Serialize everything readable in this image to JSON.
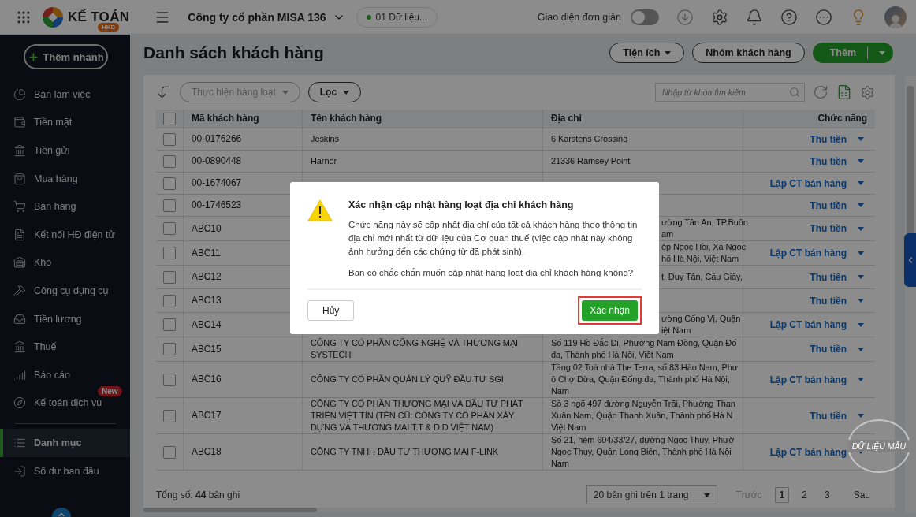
{
  "topbar": {
    "logo_text": "KẾ TOÁN",
    "logo_badge": "HKD",
    "company": "Công ty cổ phần MISA 136",
    "data_pill": "01 Dữ liệu...",
    "simple_ui": {
      "label": "Giao diện đơn giản",
      "on": false
    }
  },
  "sidebar": {
    "quick_add": "Thêm nhanh",
    "items": [
      {
        "label": "Bàn làm việc",
        "selected": false
      },
      {
        "label": "Tiền mặt",
        "selected": false
      },
      {
        "label": "Tiền gửi",
        "selected": false
      },
      {
        "label": "Mua hàng",
        "selected": false
      },
      {
        "label": "Bán hàng",
        "selected": false
      },
      {
        "label": "Kết nối HĐ điện tử",
        "selected": false
      },
      {
        "label": "Kho",
        "selected": false
      },
      {
        "label": "Công cụ dụng cụ",
        "selected": false
      },
      {
        "label": "Tiền lương",
        "selected": false
      },
      {
        "label": "Thuế",
        "selected": false
      },
      {
        "label": "Báo cáo",
        "selected": false
      },
      {
        "label": "Kế toán dịch vụ",
        "selected": false,
        "badge": "New"
      }
    ],
    "bottom_items": [
      {
        "label": "Danh mục",
        "selected": true
      },
      {
        "label": "Số dư ban đầu",
        "selected": false
      }
    ]
  },
  "page": {
    "title": "Danh sách khách hàng",
    "tools_button": "Tiện ích",
    "group_button": "Nhóm khách hàng",
    "add_button": "Thêm"
  },
  "toolbar": {
    "bulk": {
      "label": "Thực hiện hàng loạt",
      "disabled": true
    },
    "filter": "Lọc",
    "search": {
      "placeholder": "Nhập từ khóa tìm kiếm"
    }
  },
  "table": {
    "select_all": {
      "checked": false
    },
    "columns": [
      "Mã khách hàng",
      "Tên khách hàng",
      "Địa chỉ",
      "Chức năng"
    ],
    "rows": [
      {
        "code": "00-0176266",
        "name": "Jeskins",
        "address": "6 Karstens Crossing",
        "action": "Thu tiền",
        "checked": false,
        "covered": false
      },
      {
        "code": "00-0890448",
        "name": "Harnor",
        "address": "21336 Ramsey Point",
        "action": "Thu tiền",
        "checked": false,
        "covered": false
      },
      {
        "code": "00-1674067",
        "action": "Lập CT bán hàng",
        "checked": false
      },
      {
        "code": "00-1746523",
        "action": "Thu tiền",
        "checked": false
      },
      {
        "code": "ABC10",
        "address": "ường Tân An, TP.Buôn\nam",
        "action": "Thu tiền",
        "checked": false,
        "covered": true
      },
      {
        "code": "ABC11",
        "address": "ệp Ngọc Hồi, Xã Ngọc\nhố Hà Nội, Việt Nam",
        "action": "Lập CT bán hàng",
        "checked": false,
        "covered": true
      },
      {
        "code": "ABC12",
        "address": "t, Duy Tân, Cầu Giấy,",
        "action": "Thu tiền",
        "checked": false,
        "covered": true
      },
      {
        "code": "ABC13",
        "action": "Thu tiền",
        "checked": false
      },
      {
        "code": "ABC14",
        "address": "ường Cống Vị, Quận\niệt Nam",
        "action": "Lập CT bán hàng",
        "checked": false,
        "covered": true
      },
      {
        "code": "ABC15",
        "name": "CÔNG TY CỔ PHẦN CÔNG NGHỆ VÀ THƯƠNG MẠI SYSTECH",
        "address": "Số 119 Hồ Đắc Di, Phường Nam Đồng, Quận Đố\nđa, Thành phố Hà Nội, Việt Nam",
        "action": "Thu tiền",
        "checked": false,
        "covered": false
      },
      {
        "code": "ABC16",
        "name": "CÔNG TY CỔ PHẦN QUẢN LÝ QUỸ ĐẦU TƯ SGI",
        "address": "Tầng 02 Toà nhà The Terra, số 83 Hào Nam, Phư\nô Chợ Dừa, Quận Đống đa, Thành phố Hà Nội,\nNam",
        "action": "Lập CT bán hàng",
        "checked": false,
        "covered": false
      },
      {
        "code": "ABC17",
        "name": "CÔNG TY CỔ PHẦN THƯƠNG MẠI VÀ ĐẦU TƯ PHÁT TRIỂN VIỆT TÍN (TÊN CŨ: CÔNG TY CỔ PHẦN  XÂY DỰNG VÀ THƯƠNG MẠI T.T & D.D VIỆT NAM)",
        "address": "Số 3 ngõ 497 đường Nguyễn Trãi, Phường Than\nXuân Nam, Quận Thanh Xuân, Thành phố Hà N\nViệt Nam",
        "action": "Thu tiền",
        "checked": false,
        "covered": false
      },
      {
        "code": "ABC18",
        "name": "CÔNG TY TNHH ĐẦU TƯ THƯƠNG MẠI F-LINK",
        "address": "Số 21, hẻm 604/33/27, đường Ngọc Thụy, Phườ\nNgọc Thụy, Quận Long Biên, Thành phố Hà Nội\nNam",
        "action": "Lập CT bán hàng",
        "checked": false,
        "covered": false
      }
    ]
  },
  "footer": {
    "total": "Tổng số: **44** bản ghi",
    "page_size": "20 bản ghi trên 1 trang",
    "prev": {
      "label": "Trước",
      "disabled": true
    },
    "pages": [
      {
        "label": "1",
        "selected": true
      },
      {
        "label": "2",
        "selected": false
      },
      {
        "label": "3",
        "selected": false
      }
    ],
    "next": {
      "label": "Sau",
      "disabled": false
    }
  },
  "stamp": "DỮ LIỆU MẪU",
  "dialog": {
    "title": "Xác nhận cập nhật hàng loạt địa chỉ khách hàng",
    "message": "Chức năng này sẽ cập nhật địa chỉ của tất cả khách hàng theo thông tin địa chỉ mới nhất từ dữ liệu của Cơ quan thuế (việc cập nhật này không ảnh hưởng đến các chứng từ đã phát sinh).",
    "question": "Bạn có chắc chắn muốn cập nhật hàng loạt địa chỉ khách hàng không?",
    "cancel": "Hủy",
    "confirm": {
      "label": "Xác nhận",
      "highlighted": true
    }
  }
}
